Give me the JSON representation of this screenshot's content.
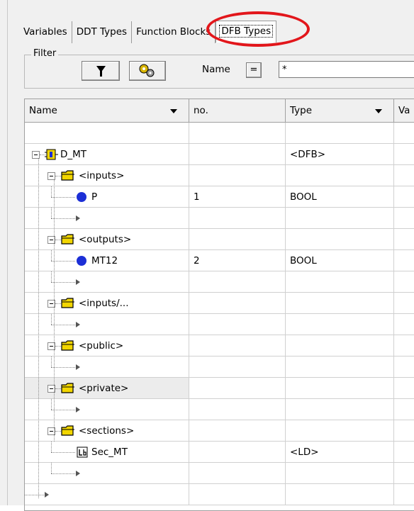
{
  "tabs": [
    {
      "label": "Variables"
    },
    {
      "label": "DDT Types"
    },
    {
      "label": "Function Blocks"
    },
    {
      "label": "DFB Types"
    }
  ],
  "filter": {
    "group_label": "Filter",
    "name_label": "Name",
    "operator": "=",
    "value": "*"
  },
  "columns": [
    {
      "label": "Name"
    },
    {
      "label": "no."
    },
    {
      "label": "Type"
    },
    {
      "label": "Va"
    }
  ],
  "rows": [
    {
      "name": "",
      "no": "",
      "type": ""
    },
    {
      "name": "D_MT",
      "no": "",
      "type": "<DFB>"
    },
    {
      "name": "<inputs>",
      "no": "",
      "type": ""
    },
    {
      "name": "P",
      "no": "1",
      "type": "BOOL"
    },
    {
      "name": "",
      "no": "",
      "type": ""
    },
    {
      "name": "<outputs>",
      "no": "",
      "type": ""
    },
    {
      "name": "MT12",
      "no": "2",
      "type": "BOOL"
    },
    {
      "name": "",
      "no": "",
      "type": ""
    },
    {
      "name": "<inputs/...",
      "no": "",
      "type": ""
    },
    {
      "name": "",
      "no": "",
      "type": ""
    },
    {
      "name": "<public>",
      "no": "",
      "type": ""
    },
    {
      "name": "",
      "no": "",
      "type": ""
    },
    {
      "name": "<private>",
      "no": "",
      "type": ""
    },
    {
      "name": "",
      "no": "",
      "type": ""
    },
    {
      "name": "<sections>",
      "no": "",
      "type": ""
    },
    {
      "name": "Sec_MT",
      "no": "",
      "type": "<LD>"
    },
    {
      "name": "",
      "no": "",
      "type": ""
    },
    {
      "name": "",
      "no": "",
      "type": ""
    }
  ],
  "colors": {
    "highlight_circle": "#e2161b",
    "variable_dot": "#1c2fd6",
    "folder": "#f2d600"
  }
}
